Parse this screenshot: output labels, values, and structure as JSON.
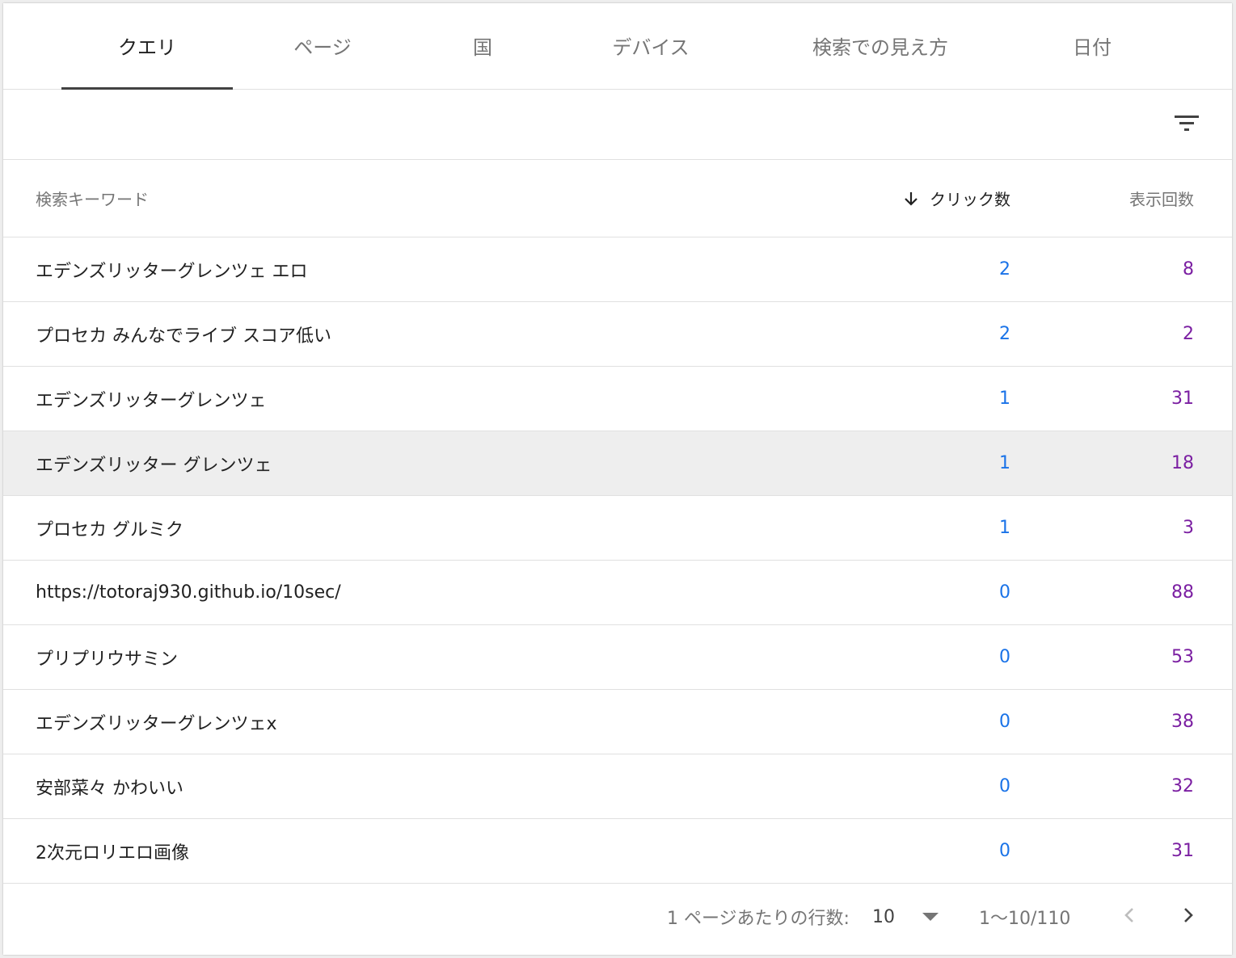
{
  "tabs": [
    {
      "label": "クエリ",
      "active": true
    },
    {
      "label": "ページ",
      "active": false
    },
    {
      "label": "国",
      "active": false
    },
    {
      "label": "デバイス",
      "active": false
    },
    {
      "label": "検索での見え方",
      "active": false
    },
    {
      "label": "日付",
      "active": false
    }
  ],
  "toolbar": {
    "filter_icon": "filter-list-icon"
  },
  "table": {
    "headers": {
      "keyword": "検索キーワード",
      "clicks": "クリック数",
      "impressions": "表示回数"
    },
    "sort_icon": "arrow-down-icon",
    "rows": [
      {
        "keyword": "エデンズリッターグレンツェ エロ",
        "clicks": "2",
        "impressions": "8"
      },
      {
        "keyword": "プロセカ みんなでライブ スコア低い",
        "clicks": "2",
        "impressions": "2"
      },
      {
        "keyword": "エデンズリッターグレンツェ",
        "clicks": "1",
        "impressions": "31"
      },
      {
        "keyword": "エデンズリッター グレンツェ",
        "clicks": "1",
        "impressions": "18"
      },
      {
        "keyword": "プロセカ グルミク",
        "clicks": "1",
        "impressions": "3"
      },
      {
        "keyword": "https://totoraj930.github.io/10sec/",
        "clicks": "0",
        "impressions": "88"
      },
      {
        "keyword": "プリプリウサミン",
        "clicks": "0",
        "impressions": "53"
      },
      {
        "keyword": "エデンズリッターグレンツェx",
        "clicks": "0",
        "impressions": "38"
      },
      {
        "keyword": "安部菜々 かわいい",
        "clicks": "0",
        "impressions": "32"
      },
      {
        "keyword": "2次元ロリエロ画像",
        "clicks": "0",
        "impressions": "31"
      }
    ]
  },
  "footer": {
    "rows_per_page_label": "1 ページあたりの行数:",
    "rows_per_page_value": "10",
    "range": "1〜10/110",
    "prev_icon": "chevron-left-icon",
    "next_icon": "chevron-right-icon"
  },
  "colors": {
    "clicks": "#1a73e8",
    "impressions": "#7b1fa2",
    "highlight_row": "#eeeeee"
  }
}
